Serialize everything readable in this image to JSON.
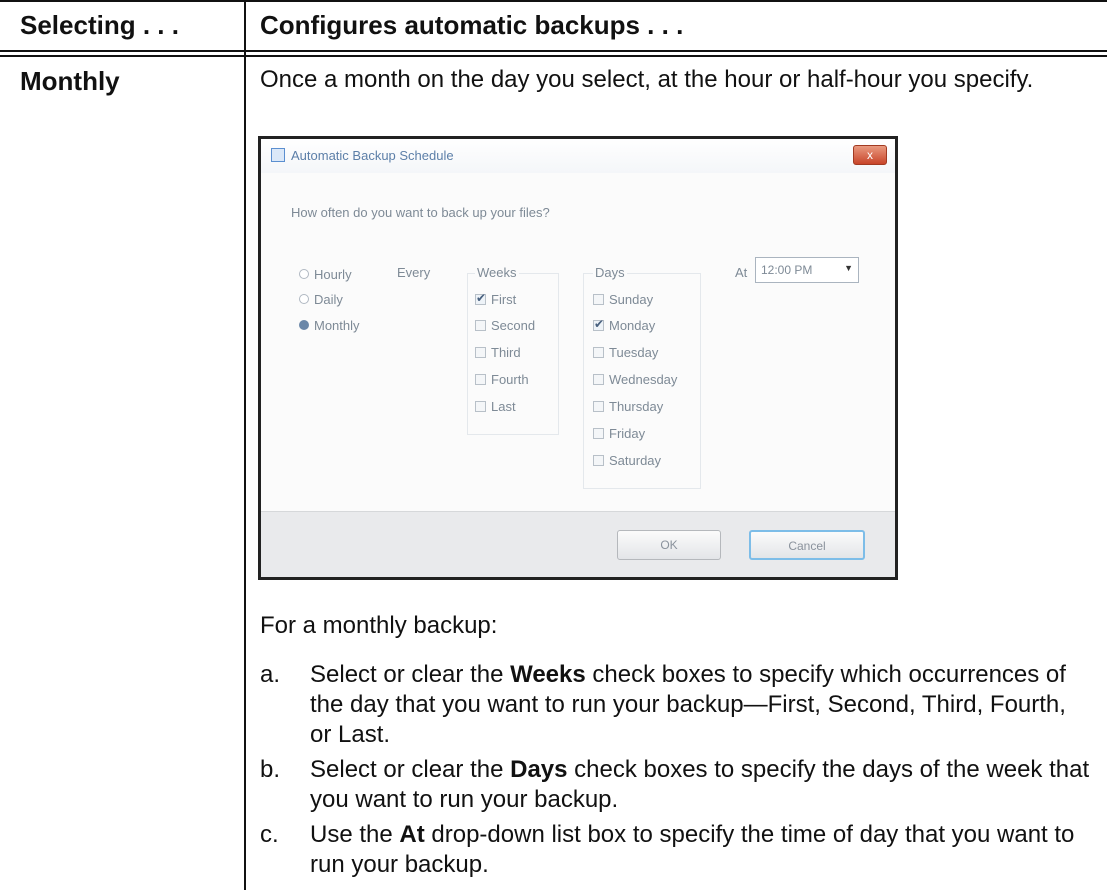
{
  "table": {
    "header_col1": "Selecting . . .",
    "header_col2": "Configures automatic backups . . .",
    "row_label": "Monthly",
    "description": "Once a month on the day you select, at the hour or half-hour you specify."
  },
  "dialog": {
    "title": "Automatic Backup Schedule",
    "question": "How often do you want to back up your files?",
    "frequency": [
      {
        "label": "Hourly",
        "selected": false
      },
      {
        "label": "Daily",
        "selected": false
      },
      {
        "label": "Monthly",
        "selected": true
      }
    ],
    "every_label": "Every",
    "weeks_title": "Weeks",
    "weeks": [
      {
        "label": "First",
        "checked": true
      },
      {
        "label": "Second",
        "checked": false
      },
      {
        "label": "Third",
        "checked": false
      },
      {
        "label": "Fourth",
        "checked": false
      },
      {
        "label": "Last",
        "checked": false
      }
    ],
    "days_title": "Days",
    "days": [
      {
        "label": "Sunday",
        "checked": false
      },
      {
        "label": "Monday",
        "checked": true
      },
      {
        "label": "Tuesday",
        "checked": false
      },
      {
        "label": "Wednesday",
        "checked": false
      },
      {
        "label": "Thursday",
        "checked": false
      },
      {
        "label": "Friday",
        "checked": false
      },
      {
        "label": "Saturday",
        "checked": false
      }
    ],
    "at_label": "At",
    "at_value": "12:00 PM",
    "ok_label": "OK",
    "cancel_label": "Cancel",
    "close_glyph": "x"
  },
  "instructions": {
    "lead": "For a monthly backup:",
    "steps": [
      {
        "marker": "a.",
        "pre": "Select or clear the ",
        "bold": "Weeks",
        "post": " check boxes to specify which occurrences of the day that you want to run your backup—First, Second, Third, Fourth, or Last."
      },
      {
        "marker": "b.",
        "pre": "Select or clear the ",
        "bold": "Days",
        "post": " check boxes to specify the days of the week that you want to run your backup."
      },
      {
        "marker": "c.",
        "pre": "Use the ",
        "bold": "At",
        "post": " drop-down list box to specify the time of day that you want to run your backup."
      }
    ]
  }
}
